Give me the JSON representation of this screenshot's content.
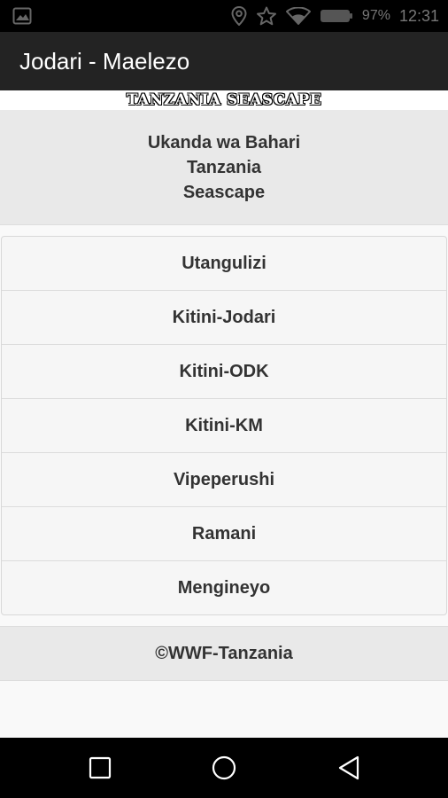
{
  "status_bar": {
    "battery_percent": "97%",
    "time": "12:31",
    "icons": [
      "image-icon",
      "location-icon",
      "star-icon",
      "wifi-icon",
      "battery-icon"
    ]
  },
  "app_bar": {
    "title": "Jodari - Maelezo"
  },
  "banner": {
    "text": "TANZANIA SEASCAPE"
  },
  "header": {
    "lines": [
      "Ukanda wa Bahari",
      "Tanzania",
      "Seascape"
    ]
  },
  "menu": {
    "items": [
      {
        "label": "Utangulizi"
      },
      {
        "label": "Kitini-Jodari"
      },
      {
        "label": "Kitini-ODK"
      },
      {
        "label": "Kitini-KM"
      },
      {
        "label": "Vipeperushi"
      },
      {
        "label": "Ramani"
      },
      {
        "label": "Mengineyo"
      }
    ]
  },
  "footer": {
    "text": "©WWF-Tanzania"
  },
  "nav_bar": {
    "icons": [
      "recent-apps-icon",
      "home-icon",
      "back-icon"
    ]
  },
  "colors": {
    "status_bar_bg": "#000000",
    "app_bar_bg": "#232323",
    "panel_bg": "#e9e9e9",
    "list_bg": "#f6f6f6",
    "text": "#333333"
  }
}
